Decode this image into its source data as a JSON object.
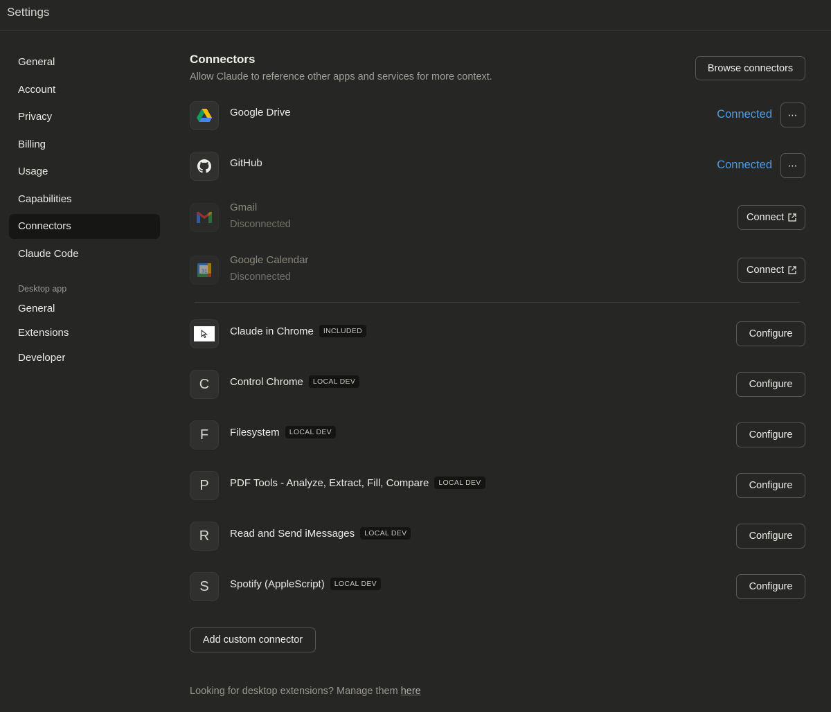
{
  "window": {
    "title": "Settings"
  },
  "sidebar": {
    "items": [
      {
        "label": "General"
      },
      {
        "label": "Account"
      },
      {
        "label": "Privacy"
      },
      {
        "label": "Billing"
      },
      {
        "label": "Usage"
      },
      {
        "label": "Capabilities"
      },
      {
        "label": "Connectors",
        "active": true
      },
      {
        "label": "Claude Code"
      }
    ],
    "section_label": "Desktop app",
    "desktop_items": [
      {
        "label": "General"
      },
      {
        "label": "Extensions"
      },
      {
        "label": "Developer"
      }
    ]
  },
  "main": {
    "title": "Connectors",
    "subtitle": "Allow Claude to reference other apps and services for more context.",
    "browse_label": "Browse connectors",
    "connectors": [
      {
        "name": "Google Drive",
        "icon": "google-drive-icon",
        "status": "Connected",
        "action": "⋯"
      },
      {
        "name": "GitHub",
        "icon": "github-icon",
        "status": "Connected",
        "action": "⋯"
      },
      {
        "name": "Gmail",
        "icon": "gmail-icon",
        "status": "Disconnected",
        "action": "Connect"
      },
      {
        "name": "Google Calendar",
        "icon": "google-calendar-icon",
        "status": "Disconnected",
        "action": "Connect",
        "calendar_day": "31"
      }
    ],
    "extensions": [
      {
        "name": "Claude in Chrome",
        "badge": "INCLUDED",
        "icon": "claude-in-chrome-icon",
        "action": "Configure"
      },
      {
        "name": "Control Chrome",
        "badge": "LOCAL DEV",
        "letter": "C",
        "action": "Configure"
      },
      {
        "name": "Filesystem",
        "badge": "LOCAL DEV",
        "letter": "F",
        "action": "Configure"
      },
      {
        "name": "PDF Tools - Analyze, Extract, Fill, Compare",
        "badge": "LOCAL DEV",
        "letter": "P",
        "action": "Configure"
      },
      {
        "name": "Read and Send iMessages",
        "badge": "LOCAL DEV",
        "letter": "R",
        "action": "Configure"
      },
      {
        "name": "Spotify (AppleScript)",
        "badge": "LOCAL DEV",
        "letter": "S",
        "action": "Configure"
      }
    ],
    "add_custom_label": "Add custom connector",
    "footer_text": "Looking for desktop extensions? Manage them ",
    "footer_link": "here"
  },
  "colors": {
    "background": "#262624",
    "accent_connected": "#4e9be6",
    "active_nav": "#161615"
  }
}
